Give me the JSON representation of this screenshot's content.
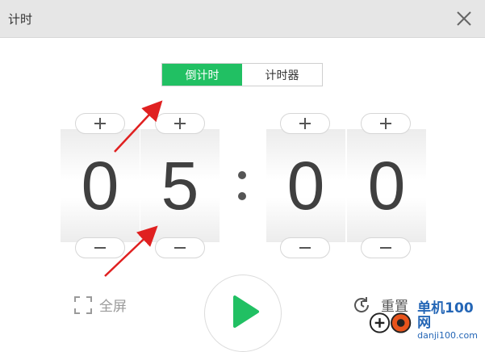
{
  "window": {
    "title": "计时"
  },
  "mode_tabs": [
    {
      "label": "倒计时",
      "active": true
    },
    {
      "label": "计时器",
      "active": false
    }
  ],
  "digits": [
    "0",
    "5",
    "0",
    "0"
  ],
  "controls": {
    "plus_label": "+",
    "minus_label": "−",
    "fullscreen_label": "全屏",
    "reset_label": "重置"
  },
  "watermark": {
    "brand": "单机100网",
    "domain": "danji100.com"
  },
  "colors": {
    "accent": "#21c063",
    "arrow": "#e02020",
    "play": "#21c063",
    "watermark": "#2466b6"
  },
  "icons": [
    "close-icon",
    "fullscreen-icon",
    "play-icon",
    "reset-icon"
  ]
}
